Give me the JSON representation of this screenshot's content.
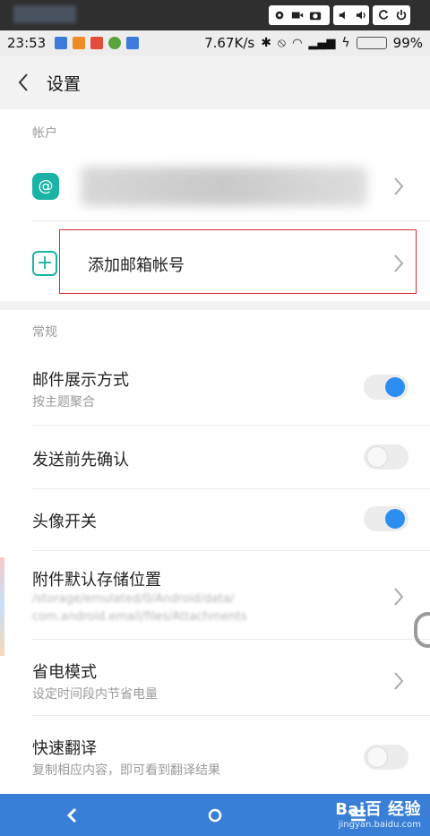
{
  "status_bar": {
    "time": "23:53",
    "network_speed": "7.67K/s",
    "battery_percent": "99%"
  },
  "header": {
    "title": "设置"
  },
  "account_section": {
    "label": "帐户",
    "add_account_label": "添加邮箱帐号"
  },
  "general_section": {
    "label": "常规",
    "items": [
      {
        "title": "邮件展示方式",
        "subtitle": "按主题聚合",
        "toggle": true
      },
      {
        "title": "发送前先确认",
        "subtitle": "",
        "toggle": false
      },
      {
        "title": "头像开关",
        "subtitle": "",
        "toggle": true
      },
      {
        "title": "附件默认存储位置",
        "subtitle_line1": "/storage/emulated/0/Android/data/",
        "subtitle_line2": "com.android.email/files/Attachments"
      },
      {
        "title": "省电模式",
        "subtitle": "设定时间段内节省电量"
      },
      {
        "title": "快速翻译",
        "subtitle": "复制相应内容，即可看到翻译结果",
        "toggle": false
      }
    ]
  },
  "watermark": {
    "line1": "Bai百 经验",
    "line2": "jingyan.baidu.com"
  },
  "colors": {
    "accent": "#2b8ef0",
    "teal": "#1bb3a6",
    "nav_bar": "#3a7fd7",
    "highlight_box": "#d32f2f"
  },
  "icons": [
    "gear-icon",
    "video-icon",
    "camera-icon",
    "volume-down-icon",
    "volume-up-icon",
    "refresh-icon",
    "power-icon",
    "back-chevron-icon",
    "at-sign-icon",
    "plus-icon",
    "chevron-right-icon",
    "nav-back-icon",
    "nav-home-icon",
    "nav-menu-icon"
  ]
}
